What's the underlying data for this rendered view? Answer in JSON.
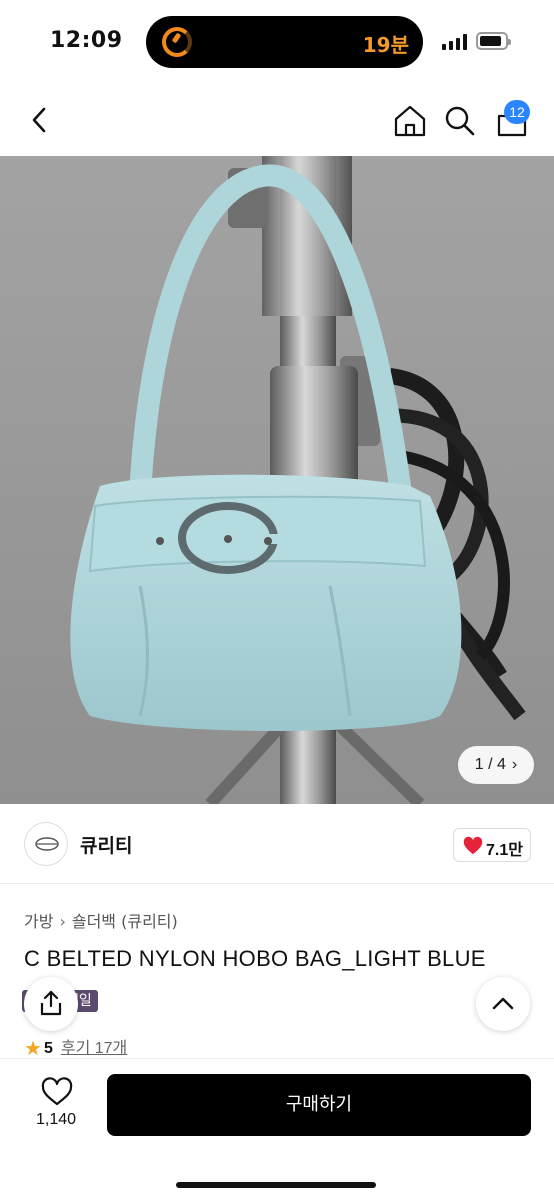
{
  "status_bar": {
    "time": "12:09",
    "island_text": "19분",
    "icons": [
      "timer-ring-icon",
      "signal-icon",
      "battery-icon"
    ]
  },
  "nav": {
    "icons": [
      "back-icon",
      "home-icon",
      "search-icon",
      "cart-icon"
    ],
    "cart_count": "12"
  },
  "product_image": {
    "counter": "1 / 4",
    "counter_icon": "chevron-right-icon"
  },
  "brand": {
    "name": "큐리티",
    "like_count": "7.1만",
    "like_icon": "heart-icon",
    "like_color": "#e5243b"
  },
  "product": {
    "breadcrumb": [
      "가방",
      "숄더백 (큐리티)"
    ],
    "title": "C BELTED NYLON HOBO BAG_LIGHT BLUE",
    "sale_badge": "세일",
    "rating_score": "5",
    "reviews": "후기 17개"
  },
  "bottom_bar": {
    "wish_count": "1,140",
    "buy_label": "구매하기",
    "buy_color": "#000000"
  },
  "colors": {
    "badge_blue": "#2a85ff",
    "star": "#f5a623",
    "sale_badge": "#5b4a6e"
  }
}
